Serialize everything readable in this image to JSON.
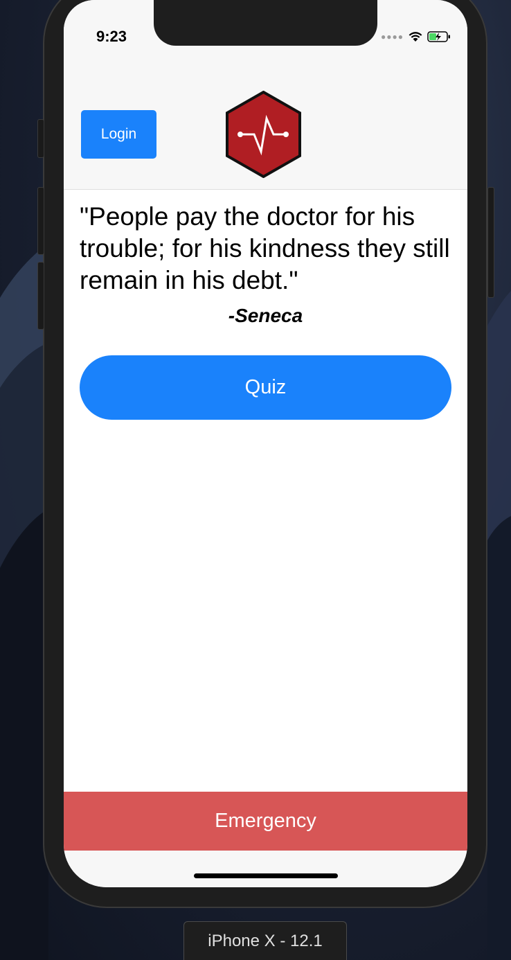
{
  "status_bar": {
    "time": "9:23"
  },
  "header": {
    "login_label": "Login"
  },
  "quote": {
    "text": "\"People pay the doctor for his trouble; for his kindness they still remain in his debt.\"",
    "author": "-Seneca"
  },
  "actions": {
    "quiz_label": "Quiz",
    "emergency_label": "Emergency"
  },
  "simulator": {
    "device_label": "iPhone X - 12.1"
  },
  "colors": {
    "primary_blue": "#1a82fb",
    "emergency_red": "#d75656",
    "logo_red": "#b01e23",
    "header_bg": "#f7f7f7"
  },
  "icons": [
    "heartbeat-hexagon-logo",
    "wifi-icon",
    "battery-charging-icon",
    "cellular-signal-icon"
  ]
}
